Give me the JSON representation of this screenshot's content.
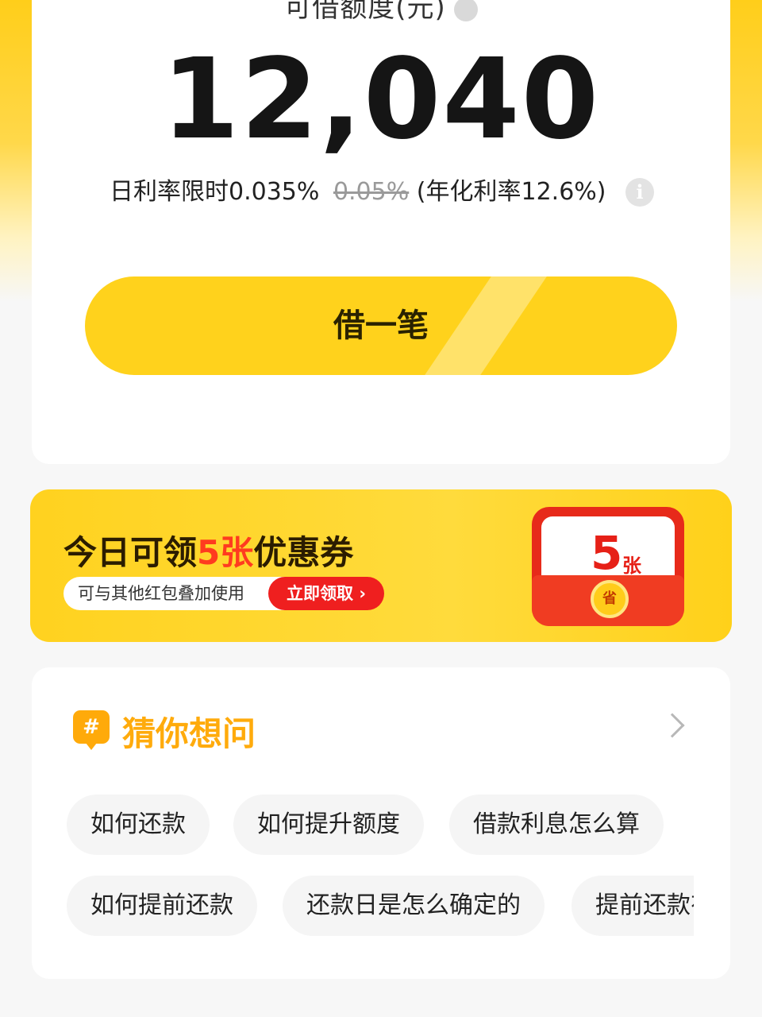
{
  "credit": {
    "limit_label": "可借额度(元)",
    "amount": "12,040",
    "rate_text": "日利率限时0.035%",
    "rate_old": "0.05%",
    "rate_annual": "(年化利率12.6%)",
    "borrow_button": "借一笔"
  },
  "coupon": {
    "title_before": "今日可领",
    "title_highlight": "5张",
    "title_after": "优惠券",
    "subtitle": "可与其他红包叠加使用",
    "claim_button": "立即领取 ›",
    "envelope_number": "5",
    "envelope_unit": "张",
    "coin_text": "省"
  },
  "faq": {
    "icon": "#",
    "title": "猜你想问",
    "questions_row1": [
      "如何还款",
      "如何提升额度",
      "借款利息怎么算"
    ],
    "questions_row2": [
      "如何提前还款",
      "还款日是怎么确定的",
      "提前还款有"
    ]
  }
}
